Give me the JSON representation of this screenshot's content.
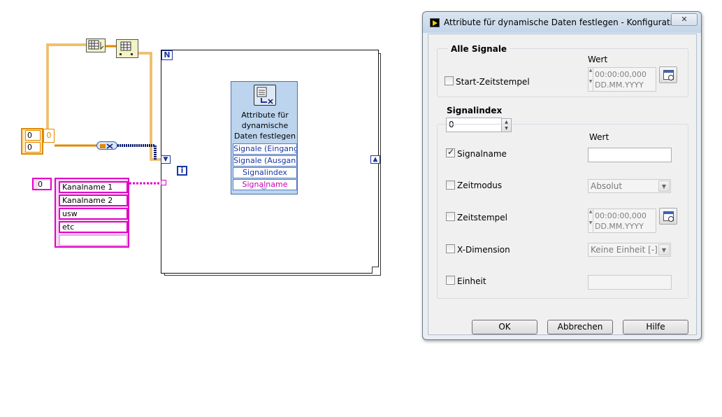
{
  "block_diagram": {
    "loop_count_label": "N",
    "iteration_label": "i",
    "express_vi": {
      "title": "Attribute für\ndynamische\nDaten festlegen",
      "terminals": [
        "Signale (Eingang)",
        "Signale (Ausgang)",
        "Signalindex",
        "Signalname"
      ]
    },
    "numeric_constants": [
      "0",
      "0"
    ],
    "numeric_array_index": "0",
    "string_array_index": "0",
    "string_array": [
      "Kanalname 1",
      "Kanalname 2",
      "usw",
      "etc",
      ""
    ]
  },
  "dialog": {
    "title": "Attribute für dynamische Daten festlegen - Konfiguration",
    "close_label": "✕",
    "alle_signale": {
      "header": "Alle Signale",
      "wert_label": "Wert",
      "start_zeitstempel_label": "Start-Zeitstempel",
      "start_zeitstempel_checked": false,
      "time_value": "00:00:00,000",
      "date_value": "DD.MM.YYYY"
    },
    "signalindex": {
      "header": "Signalindex",
      "value": "0",
      "wert_label": "Wert",
      "signalname": {
        "label": "Signalname",
        "checked": true,
        "value": ""
      },
      "zeitmodus": {
        "label": "Zeitmodus",
        "checked": false,
        "value": "Absolut"
      },
      "zeitstempel": {
        "label": "Zeitstempel",
        "checked": false,
        "time_value": "00:00:00,000",
        "date_value": "DD.MM.YYYY"
      },
      "x_dimension": {
        "label": "X-Dimension",
        "checked": false,
        "value": "Keine Einheit [-]"
      },
      "einheit": {
        "label": "Einheit",
        "checked": false,
        "value": ""
      }
    },
    "buttons": {
      "ok": "OK",
      "cancel": "Abbrechen",
      "help": "Hilfe"
    }
  }
}
